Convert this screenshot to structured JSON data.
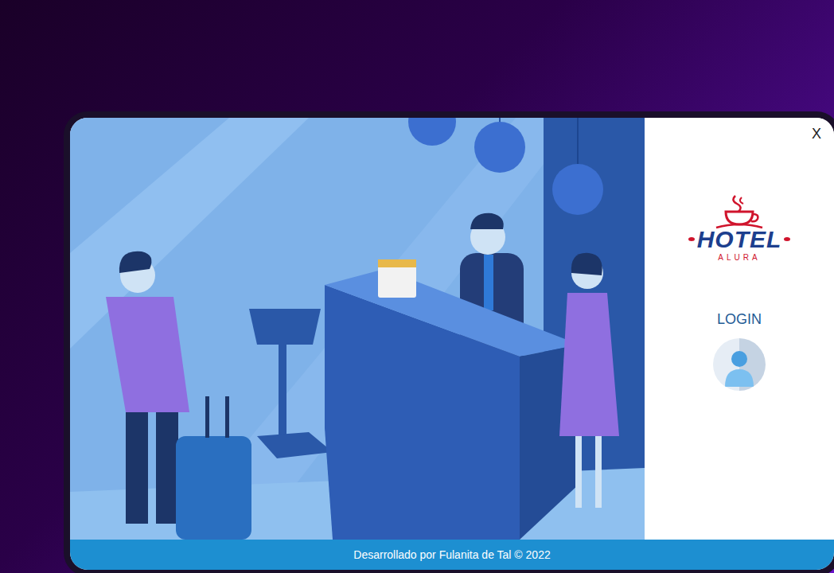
{
  "window": {
    "close": "X"
  },
  "logo": {
    "name": "HOTEL",
    "subtitle": "ALURA"
  },
  "login": {
    "label": "LOGIN"
  },
  "footer": {
    "text": "Desarrollado por Fulanita de Tal © 2022"
  }
}
